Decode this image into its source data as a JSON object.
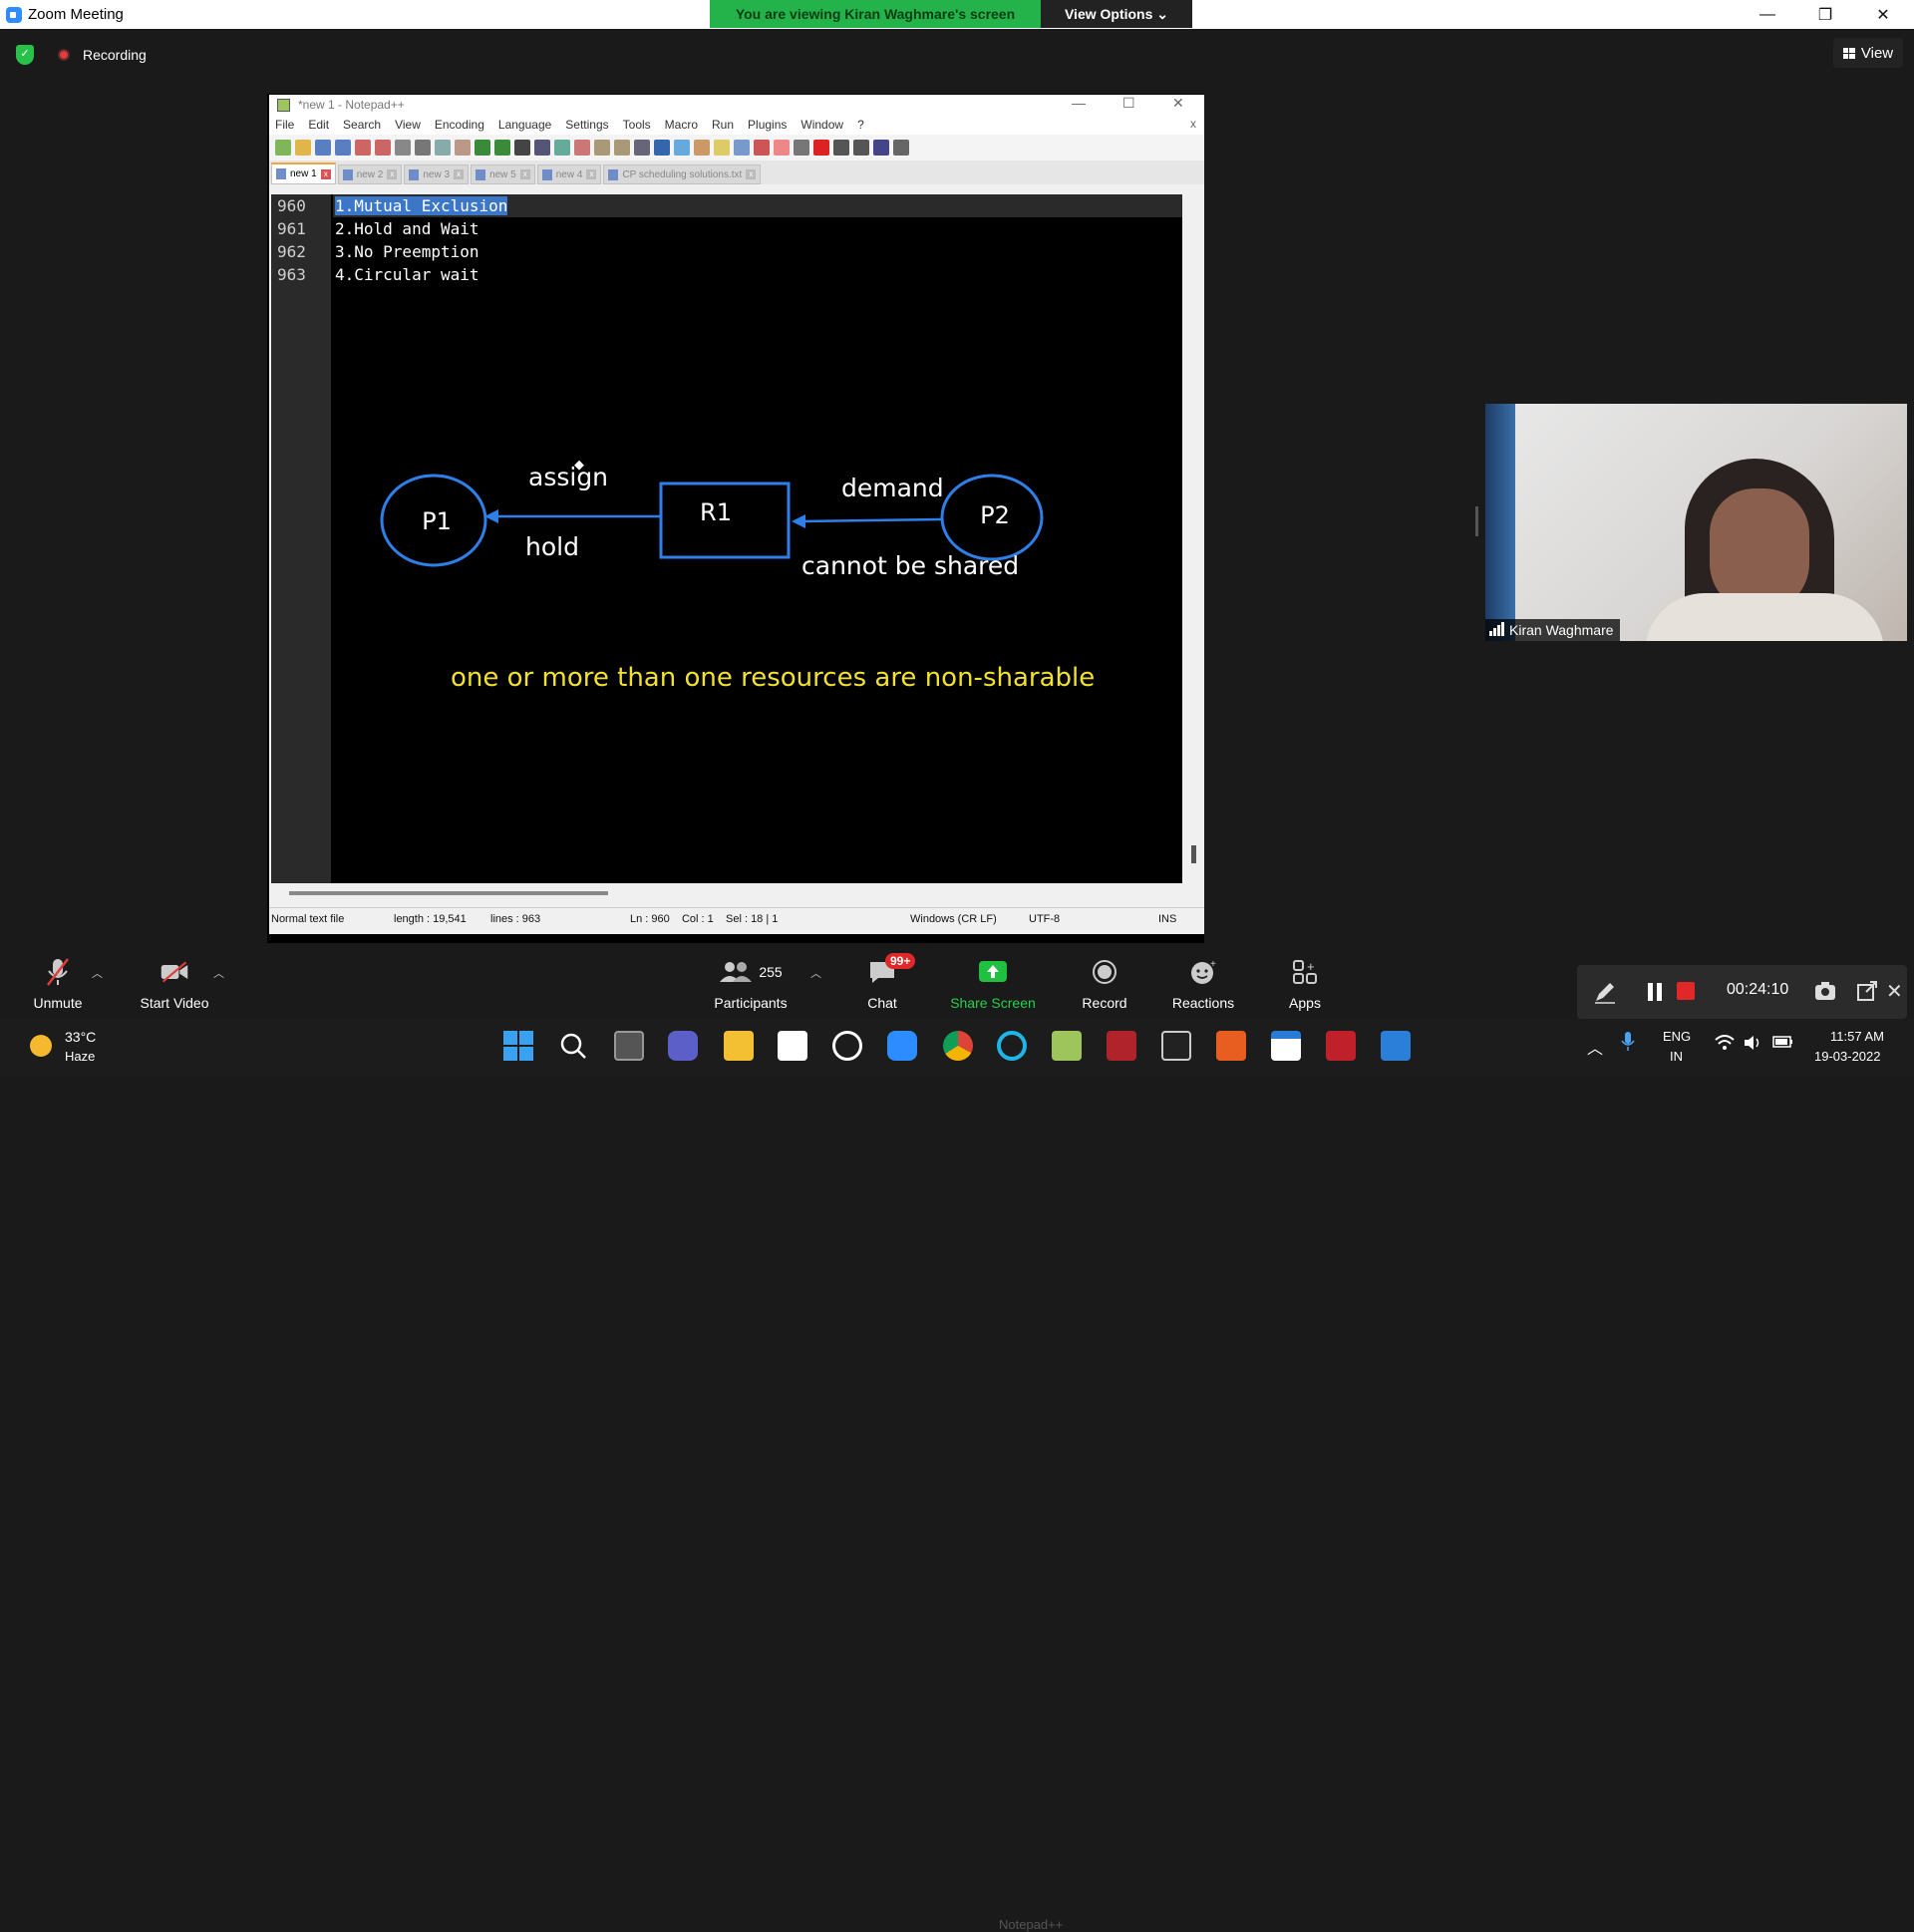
{
  "window": {
    "title": "Zoom Meeting"
  },
  "banner": {
    "viewing": "You are viewing Kiran Waghmare's screen",
    "view_options": "View Options ⌄"
  },
  "window_controls": {
    "minimize": "—",
    "restore": "❐",
    "close": "✕"
  },
  "topbar": {
    "recording_label": "Recording",
    "view_label": "View"
  },
  "notepad": {
    "title": "*new 1 - Notepad++",
    "menu": [
      "File",
      "Edit",
      "Search",
      "View",
      "Encoding",
      "Language",
      "Settings",
      "Tools",
      "Macro",
      "Run",
      "Plugins",
      "Window",
      "?"
    ],
    "tabs": [
      "new 1",
      "new 2",
      "new 3",
      "new 5",
      "new 4",
      "CP scheduling solutions.txt"
    ],
    "line_numbers": [
      "960",
      "961",
      "962",
      "963"
    ],
    "lines": [
      "1.Mutual Exclusion",
      "2.Hold and Wait",
      "3.No Preemption",
      "4.Circular wait"
    ],
    "status": {
      "type": "Normal text file",
      "length": "length : 19,541",
      "lines": "lines : 963",
      "position": "Ln : 960    Col : 1    Sel : 18 | 1",
      "eol": "Windows (CR LF)",
      "encoding": "UTF-8",
      "mode": "INS"
    }
  },
  "drawing": {
    "p1": "P1",
    "r1": "R1",
    "p2": "P2",
    "assign": "assign",
    "hold": "hold",
    "demand": "demand",
    "cannot_share": "cannot be shared",
    "note": "one or more than one resources are non-sharable",
    "stroke_color": "#2f7fe8",
    "note_color": "#f2e12e"
  },
  "participant": {
    "name": "Kiran Waghmare"
  },
  "toolbar": {
    "unmute": "Unmute",
    "start_video": "Start Video",
    "participants": "Participants",
    "participant_count": "255",
    "chat": "Chat",
    "chat_badge": "99+",
    "share_screen": "Share Screen",
    "share_tooltip": "Notepad++",
    "record": "Record",
    "reactions": "Reactions",
    "apps": "Apps",
    "timer": "00:24:10"
  },
  "taskbar": {
    "temp": "33°C",
    "weather": "Haze",
    "lang_top": "ENG",
    "lang_bottom": "IN",
    "time": "11:57 AM",
    "date": "19-03-2022"
  }
}
